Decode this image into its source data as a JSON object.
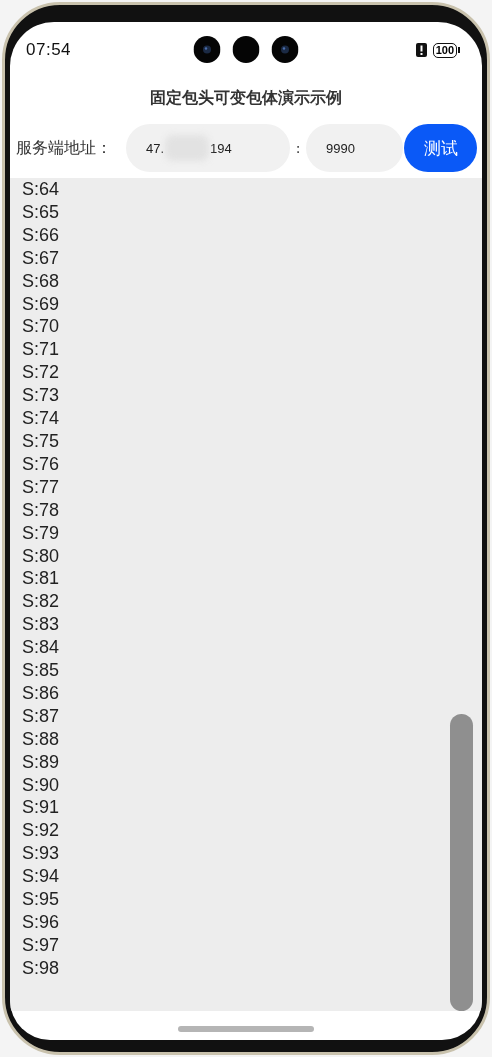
{
  "status_bar": {
    "time": "07:54",
    "battery": "100"
  },
  "title": "固定包头可变包体演示示例",
  "server": {
    "label": "服务端地址：",
    "address_start": "47.",
    "address_end": "194",
    "separator": ":",
    "port": "9990",
    "button": "测试"
  },
  "log": [
    "S:64",
    "S:65",
    "S:66",
    "S:67",
    "S:68",
    "S:69",
    "S:70",
    "S:71",
    "S:72",
    "S:73",
    "S:74",
    "S:75",
    "S:76",
    "S:77",
    "S:78",
    "S:79",
    "S:80",
    "S:81",
    "S:82",
    "S:83",
    "S:84",
    "S:85",
    "S:86",
    "S:87",
    "S:88",
    "S:89",
    "S:90",
    "S:91",
    "S:92",
    "S:93",
    "S:94",
    "S:95",
    "S:96",
    "S:97",
    "S:98"
  ]
}
